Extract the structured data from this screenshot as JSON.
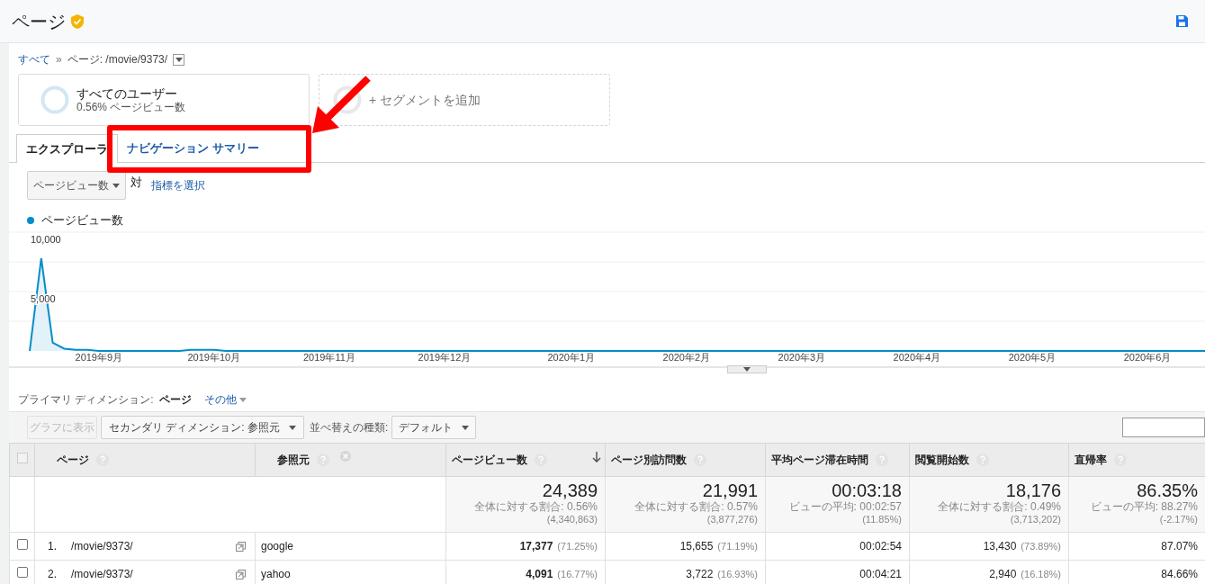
{
  "header": {
    "title": "ページ"
  },
  "breadcrumb": {
    "root": "すべて",
    "separator": "»",
    "current": "ページ: /movie/9373/"
  },
  "segments": [
    {
      "kind": "segment",
      "name": "すべてのユーザー",
      "detail": "0.56% ページビュー数"
    },
    {
      "kind": "add",
      "name": "+ セグメントを追加"
    }
  ],
  "tabs": [
    {
      "label": "エクスプローラ",
      "selected": true
    },
    {
      "label": "ナビゲーション サマリー",
      "selected": false
    }
  ],
  "metric_picker": {
    "value": "ページビュー数",
    "versus": "対",
    "link": "指標を選択"
  },
  "chart": {
    "chart_data": {
      "type": "area",
      "ylim": [
        0,
        10000
      ],
      "yticks": [
        {
          "value": 5000,
          "label": "5,000"
        },
        {
          "value": 10000,
          "label": "10,000"
        }
      ],
      "categories": [
        null,
        null,
        null,
        null,
        null,
        null,
        "2019年9月",
        null,
        null,
        null,
        null,
        null,
        null,
        null,
        null,
        null,
        "2019年10月",
        null,
        null,
        null,
        null,
        null,
        null,
        null,
        null,
        null,
        "2019年11月",
        null,
        null,
        null,
        null,
        null,
        null,
        null,
        null,
        null,
        "2019年12月",
        null,
        null,
        null,
        null,
        null,
        null,
        null,
        null,
        null,
        null,
        "2020年1月",
        null,
        null,
        null,
        null,
        null,
        null,
        null,
        null,
        null,
        "2020年2月",
        null,
        null,
        null,
        null,
        null,
        null,
        null,
        null,
        null,
        "2020年3月",
        null,
        null,
        null,
        null,
        null,
        null,
        null,
        null,
        null,
        "2020年4月",
        null,
        null,
        null,
        null,
        null,
        null,
        null,
        null,
        null,
        "2020年5月",
        null,
        null,
        null,
        null,
        null,
        null,
        null,
        null,
        null,
        "2020年6月",
        null,
        null,
        null,
        null,
        null
      ],
      "series": [
        {
          "name": "ページビュー数",
          "color": "#058dc7",
          "values": [
            0,
            7800,
            700,
            200,
            100,
            100,
            0,
            0,
            0,
            0,
            0,
            0,
            0,
            0,
            100,
            100,
            100,
            0,
            0,
            0,
            0,
            0,
            0,
            0,
            0,
            0,
            0,
            0,
            0,
            0,
            0,
            0,
            0,
            0,
            0,
            0,
            0,
            0,
            0,
            0,
            0,
            0,
            0,
            0,
            0,
            0,
            0,
            0,
            0,
            0,
            0,
            0,
            0,
            0,
            0,
            0,
            0,
            0,
            0,
            0,
            0,
            0,
            0,
            0,
            0,
            0,
            0,
            0,
            0,
            0,
            0,
            0,
            0,
            0,
            0,
            0,
            0,
            0,
            0,
            0,
            0,
            0,
            0,
            0,
            0,
            0,
            0,
            0,
            0,
            0,
            0,
            0,
            0,
            0,
            0,
            0,
            0,
            0,
            0,
            0,
            0,
            0,
            0
          ]
        }
      ]
    }
  },
  "primary_dimension": {
    "label": "プライマリ ディメンション:",
    "options": [
      {
        "label": "ページ",
        "selected": true
      },
      {
        "label": "その他",
        "selected": false
      }
    ]
  },
  "toolbar": {
    "chart_button": {
      "label": "グラフに表示",
      "disabled": true
    },
    "secondary_dimension": "セカンダリ ディメンション: 参照元",
    "sort_label": "並べ替えの種類:",
    "sort_value": "デフォルト"
  },
  "table": {
    "select_all": {
      "checked": false
    },
    "columns": [
      {
        "label": "ページ",
        "kind": "dimension",
        "removable": false,
        "sorted": false
      },
      {
        "label": "参照元",
        "kind": "dimension",
        "removable": true,
        "sorted": false
      },
      {
        "label": "ページビュー数",
        "kind": "metric",
        "sorted": true
      },
      {
        "label": "ページ別訪問数",
        "kind": "metric",
        "sorted": false
      },
      {
        "label": "平均ページ滞在時間",
        "kind": "metric",
        "sorted": false
      },
      {
        "label": "閲覧開始数",
        "kind": "metric",
        "sorted": false
      },
      {
        "label": "直帰率",
        "kind": "metric",
        "sorted": false
      }
    ],
    "totals": [
      {
        "value": "24,389",
        "note": "全体に対する割合: 0.56%",
        "base": "(4,340,863)"
      },
      {
        "value": "21,991",
        "note": "全体に対する割合: 0.57%",
        "base": "(3,877,276)"
      },
      {
        "value": "00:03:18",
        "note": "ビューの平均: 00:02:57",
        "base": "(11.85%)"
      },
      {
        "value": "18,176",
        "note": "全体に対する割合: 0.49%",
        "base": "(3,713,202)"
      },
      {
        "value": "86.35%",
        "note": "ビューの平均: 88.27%",
        "base": "(-2.17%)"
      }
    ],
    "rows": [
      {
        "checked": false,
        "cells": [
          {
            "index": "1.",
            "value": "/movie/9373/"
          },
          {
            "value": "google"
          },
          {
            "value": "17,377",
            "share": "(71.25%)"
          },
          {
            "value": "15,655",
            "share": "(71.19%)"
          },
          {
            "value": "00:02:54"
          },
          {
            "value": "13,430",
            "share": "(73.89%)"
          },
          {
            "value": "87.07%"
          }
        ]
      },
      {
        "checked": false,
        "cells": [
          {
            "index": "2.",
            "value": "/movie/9373/"
          },
          {
            "value": "yahoo"
          },
          {
            "value": "4,091",
            "share": "(16.77%)"
          },
          {
            "value": "3,722",
            "share": "(16.93%)"
          },
          {
            "value": "00:04:21"
          },
          {
            "value": "2,940",
            "share": "(16.18%)"
          },
          {
            "value": "84.66%"
          }
        ]
      }
    ]
  }
}
